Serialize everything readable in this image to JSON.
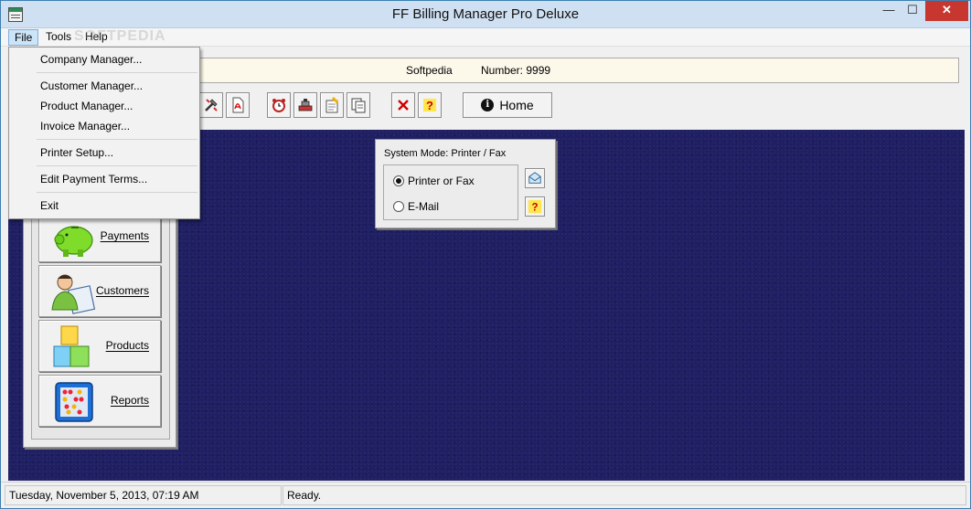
{
  "window": {
    "title": "FF Billing Manager Pro Deluxe",
    "minimize_glyph": "—",
    "maximize_glyph": "☐",
    "close_glyph": "✕"
  },
  "menu": {
    "items": [
      "File",
      "Tools",
      "Help"
    ],
    "active": "File"
  },
  "watermark": "SOFTPEDIA",
  "file_menu": {
    "items": [
      "Company Manager...",
      "Customer Manager...",
      "Product Manager...",
      "Invoice Manager...",
      "Printer Setup...",
      "Edit Payment Terms...",
      "Exit"
    ]
  },
  "info": {
    "company": "Softpedia",
    "number": "Number: 9999"
  },
  "toolbar": {
    "icons": [
      "tools-icon",
      "pdf-icon",
      "alarm-clock-icon",
      "stamp-icon",
      "notes-icon",
      "copy-icon",
      "delete-icon",
      "help-icon"
    ],
    "home_label": "Home"
  },
  "nav": {
    "payments": "Payments",
    "customers": "Customers",
    "products": "Products",
    "reports": "Reports"
  },
  "mode": {
    "title": "System Mode: Printer / Fax",
    "options": [
      "Printer or Fax",
      "E-Mail"
    ],
    "selected": "Printer or Fax",
    "help_glyph": "?"
  },
  "status": {
    "datetime": "Tuesday, November 5, 2013, 07:19 AM",
    "message": "Ready."
  },
  "colors": {
    "workspace": "#1f1f63",
    "info_strip": "#fcf8ea",
    "close_button": "#c7372f"
  }
}
